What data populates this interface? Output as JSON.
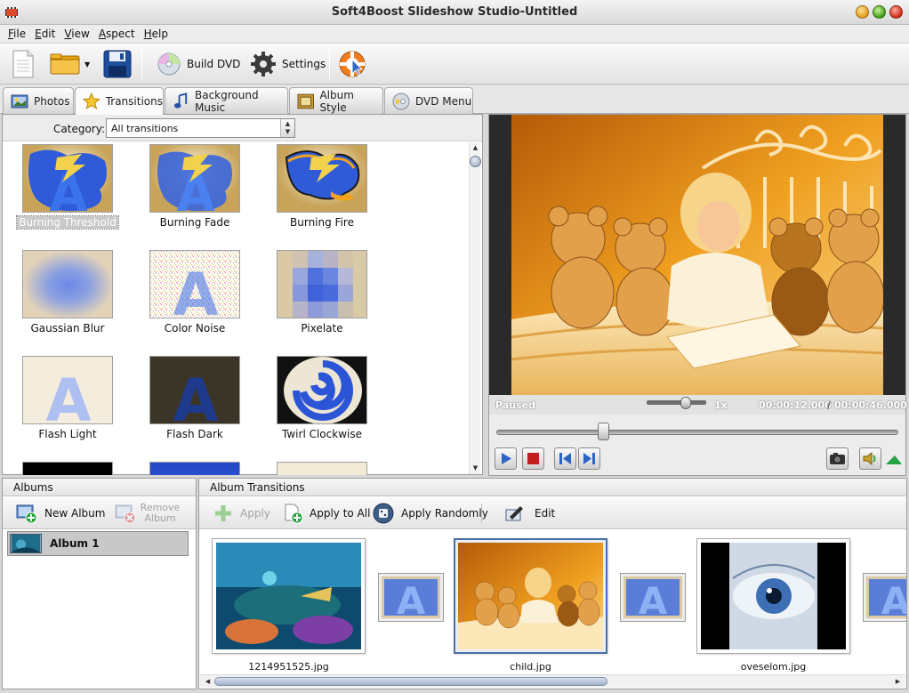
{
  "window": {
    "title": "Soft4Boost Slideshow Studio-Untitled"
  },
  "menu": [
    {
      "label": "File",
      "u": "F",
      "rest": "ile"
    },
    {
      "label": "Edit",
      "u": "E",
      "rest": "dit"
    },
    {
      "label": "View",
      "u": "V",
      "rest": "iew"
    },
    {
      "label": "Aspect",
      "u": "A",
      "rest": "spect"
    },
    {
      "label": "Help",
      "u": "H",
      "rest": "elp"
    }
  ],
  "toolbar": {
    "build_dvd": "Build DVD",
    "settings": "Settings"
  },
  "tabs": {
    "photos": "Photos",
    "transitions": "Transitions",
    "background_music": "Background Music",
    "album_style": "Album Style",
    "dvd_menu": "DVD Menu"
  },
  "category": {
    "label": "Category:",
    "value": "All transitions"
  },
  "transitions": [
    {
      "name": "Burning Threshold",
      "selected": true
    },
    {
      "name": "Burning Fade"
    },
    {
      "name": "Burning Fire"
    },
    {
      "name": "Gaussian Blur"
    },
    {
      "name": "Color Noise"
    },
    {
      "name": "Pixelate"
    },
    {
      "name": "Flash Light"
    },
    {
      "name": "Flash Dark"
    },
    {
      "name": "Twirl Clockwise"
    }
  ],
  "preview": {
    "status": "Paused",
    "speed": "1x",
    "time_current": "00:00:12.000",
    "time_separator": "/",
    "time_total": "00:00:46.000",
    "position_fraction": 0.26
  },
  "albums": {
    "header": "Albums",
    "new_album": "New Album",
    "remove_album": "Remove Album",
    "items": [
      {
        "name": "Album 1"
      }
    ]
  },
  "album_transitions": {
    "header": "Album Transitions",
    "apply": "Apply",
    "apply_to_all": "Apply to All",
    "apply_randomly": "Apply Randomly",
    "edit": "Edit",
    "slides": [
      {
        "file": "1214951525.jpg"
      },
      {
        "file": "child.jpg",
        "selected": true
      },
      {
        "file": "oveselom.jpg"
      }
    ]
  },
  "colors": {
    "accent": "#4a6fa5",
    "selection": "#c9c9c9",
    "photo_warm": "#f0a020"
  }
}
